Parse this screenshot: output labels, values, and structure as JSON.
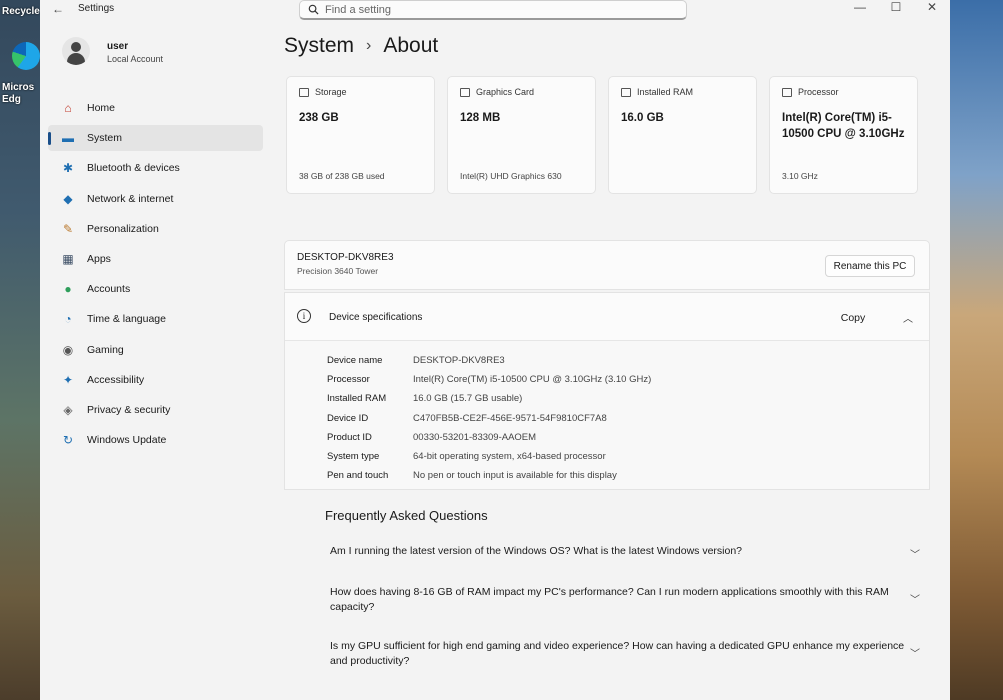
{
  "desktop": {
    "recycle_label": "Recycle",
    "edge_label_1": "Micros",
    "edge_label_2": "Edg"
  },
  "window": {
    "title": "Settings",
    "back_icon": "back-arrow-icon"
  },
  "search": {
    "placeholder": "Find a setting"
  },
  "user": {
    "name": "user",
    "account_type": "Local Account"
  },
  "nav": [
    {
      "label": "Home",
      "icon": "home-icon",
      "glyph": "⌂",
      "color": "#c0392b"
    },
    {
      "label": "System",
      "icon": "monitor-icon",
      "glyph": "▬",
      "color": "#1f6fb2",
      "active": true
    },
    {
      "label": "Bluetooth & devices",
      "icon": "bluetooth-icon",
      "glyph": "✱",
      "color": "#1f6fb2"
    },
    {
      "label": "Network & internet",
      "icon": "wifi-icon",
      "glyph": "◆",
      "color": "#1f6fb2"
    },
    {
      "label": "Personalization",
      "icon": "brush-icon",
      "glyph": "✎",
      "color": "#b9772b"
    },
    {
      "label": "Apps",
      "icon": "apps-icon",
      "glyph": "▦",
      "color": "#3d4f66"
    },
    {
      "label": "Accounts",
      "icon": "accounts-icon",
      "glyph": "●",
      "color": "#2e9e5b"
    },
    {
      "label": "Time & language",
      "icon": "globe-clock-icon",
      "glyph": "◔",
      "color": "#1f6fb2"
    },
    {
      "label": "Gaming",
      "icon": "gamepad-icon",
      "glyph": "◉",
      "color": "#555555"
    },
    {
      "label": "Accessibility",
      "icon": "accessibility-icon",
      "glyph": "✦",
      "color": "#1f6fb2"
    },
    {
      "label": "Privacy & security",
      "icon": "shield-icon",
      "glyph": "◈",
      "color": "#666666"
    },
    {
      "label": "Windows Update",
      "icon": "update-icon",
      "glyph": "↻",
      "color": "#1f6fb2"
    }
  ],
  "breadcrumb": {
    "parent": "System",
    "separator": "›",
    "current": "About"
  },
  "cards": [
    {
      "title": "Storage",
      "value": "238 GB",
      "foot": "38 GB of 238 GB used",
      "icon": "storage-icon"
    },
    {
      "title": "Graphics Card",
      "value": "128 MB",
      "foot": "Intel(R) UHD Graphics 630",
      "icon": "graphics-card-icon"
    },
    {
      "title": "Installed RAM",
      "value": "16.0 GB",
      "foot": "",
      "icon": "ram-icon"
    },
    {
      "title": "Processor",
      "value": "Intel(R) Core(TM) i5-10500 CPU @ 3.10GHz",
      "foot": "3.10 GHz",
      "icon": "processor-icon"
    }
  ],
  "device": {
    "name": "DESKTOP-DKV8RE3",
    "model": "Precision 3640 Tower",
    "rename_label": "Rename this PC"
  },
  "specs": {
    "title": "Device specifications",
    "copy_label": "Copy",
    "rows": [
      {
        "key": "Device name",
        "value": "DESKTOP-DKV8RE3"
      },
      {
        "key": "Processor",
        "value": "Intel(R) Core(TM) i5-10500 CPU @ 3.10GHz (3.10 GHz)"
      },
      {
        "key": "Installed RAM",
        "value": "16.0 GB (15.7 GB usable)"
      },
      {
        "key": "Device ID",
        "value": "C470FB5B-CE2F-456E-9571-54F9810CF7A8"
      },
      {
        "key": "Product ID",
        "value": "00330-53201-83309-AAOEM"
      },
      {
        "key": "System type",
        "value": "64-bit operating system, x64-based processor"
      },
      {
        "key": "Pen and touch",
        "value": "No pen or touch input is available for this display"
      }
    ]
  },
  "faq": {
    "title": "Frequently Asked Questions",
    "items": [
      "Am I running the latest version of the Windows OS? What is the latest Windows version?",
      "How does having 8-16 GB of RAM impact my PC's performance? Can I run modern applications smoothly with this RAM capacity?",
      "Is my GPU sufficient for high end gaming and video experience? How can having a dedicated GPU enhance my experience and productivity?"
    ]
  }
}
